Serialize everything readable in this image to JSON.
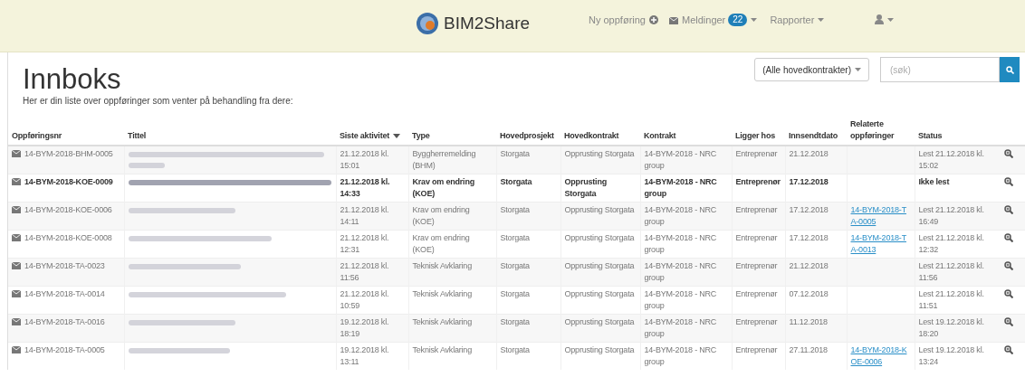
{
  "navbar": {
    "brand": "BIM2Share",
    "new_entry": "Ny oppføring",
    "messages": {
      "label": "Meldinger",
      "count": "22"
    },
    "reports": "Rapporter"
  },
  "page": {
    "title": "Innboks",
    "subtitle": "Her er din liste over oppføringer som venter på behandling fra dere:",
    "contract_filter": "(Alle hovedkontrakter)",
    "search": {
      "placeholder": "(søk)"
    }
  },
  "table": {
    "columns": [
      {
        "label": "Oppføringsnr",
        "sorted": false
      },
      {
        "label": "Tittel",
        "sorted": false
      },
      {
        "label": "Siste aktivitet",
        "sorted": true
      },
      {
        "label": "Type",
        "sorted": false
      },
      {
        "label": "Hovedprosjekt",
        "sorted": false
      },
      {
        "label": "Hovedkontrakt",
        "sorted": false
      },
      {
        "label": "Kontrakt",
        "sorted": false
      },
      {
        "label": "Ligger hos",
        "sorted": false
      },
      {
        "label": "Innsendtdato",
        "sorted": false
      },
      {
        "label": "Relaterte oppføringer",
        "sorted": false
      },
      {
        "label": "Status",
        "sorted": false
      }
    ],
    "rows": [
      {
        "number": "14-BYM-2018-BHM-0005",
        "unread": false,
        "activity": "21.12.2018 kl. 15:01",
        "type": "Byggherremelding (BHM)",
        "project": "Storgata",
        "main_contract": "Opprusting Storgata",
        "contract": "14-BYM-2018 - NRC group",
        "assigned_to": "Entreprenør",
        "submitted": "21.12.2018",
        "status": "Lest 21.12.2018 kl. 15:02"
      },
      {
        "number": "14-BYM-2018-KOE-0009",
        "unread": true,
        "activity": "21.12.2018 kl. 14:33",
        "type": "Krav om endring (KOE)",
        "project": "Storgata",
        "main_contract": "Opprusting Storgata",
        "contract": "14-BYM-2018 - NRC group",
        "assigned_to": "Entreprenør",
        "submitted": "17.12.2018",
        "status": "Ikke lest"
      },
      {
        "number": "14-BYM-2018-KOE-0006",
        "unread": false,
        "activity": "21.12.2018 kl. 14:11",
        "type": "Krav om endring (KOE)",
        "project": "Storgata",
        "main_contract": "Opprusting Storgata",
        "contract": "14-BYM-2018 - NRC group",
        "assigned_to": "Entreprenør",
        "submitted": "17.12.2018",
        "related": "14-BYM-2018-TA-0005",
        "status": "Lest 21.12.2018 kl. 16:49"
      },
      {
        "number": "14-BYM-2018-KOE-0008",
        "unread": false,
        "activity": "21.12.2018 kl. 12:31",
        "type": "Krav om endring (KOE)",
        "project": "Storgata",
        "main_contract": "Opprusting Storgata",
        "contract": "14-BYM-2018 - NRC group",
        "assigned_to": "Entreprenør",
        "submitted": "17.12.2018",
        "related": "14-BYM-2018-TA-0013",
        "status": "Lest 21.12.2018 kl. 12:32"
      },
      {
        "number": "14-BYM-2018-TA-0023",
        "unread": false,
        "activity": "21.12.2018 kl. 11:56",
        "type": "Teknisk Avklaring",
        "project": "Storgata",
        "main_contract": "Opprusting Storgata",
        "contract": "14-BYM-2018 - NRC group",
        "assigned_to": "Entreprenør",
        "submitted": "21.12.2018",
        "status": "Lest 21.12.2018 kl. 11:56"
      },
      {
        "number": "14-BYM-2018-TA-0014",
        "unread": false,
        "activity": "21.12.2018 kl. 10:59",
        "type": "Teknisk Avklaring",
        "project": "Storgata",
        "main_contract": "Opprusting Storgata",
        "contract": "14-BYM-2018 - NRC group",
        "assigned_to": "Entreprenør",
        "submitted": "07.12.2018",
        "status": "Lest 21.12.2018 kl. 11:51"
      },
      {
        "number": "14-BYM-2018-TA-0016",
        "unread": false,
        "activity": "19.12.2018 kl. 18:19",
        "type": "Teknisk Avklaring",
        "project": "Storgata",
        "main_contract": "Opprusting Storgata",
        "contract": "14-BYM-2018 - NRC group",
        "assigned_to": "Entreprenør",
        "submitted": "11.12.2018",
        "status": "Lest 19.12.2018 kl. 18:20"
      },
      {
        "number": "14-BYM-2018-TA-0005",
        "unread": false,
        "activity": "19.12.2018 kl. 13:11",
        "type": "Teknisk Avklaring",
        "project": "Storgata",
        "main_contract": "Opprusting Storgata",
        "contract": "14-BYM-2018 - NRC group",
        "assigned_to": "Entreprenør",
        "submitted": "27.11.2018",
        "related": "14-BYM-2018-KOE-0006",
        "status": "Lest 19.12.2018 kl. 13:24"
      }
    ]
  }
}
